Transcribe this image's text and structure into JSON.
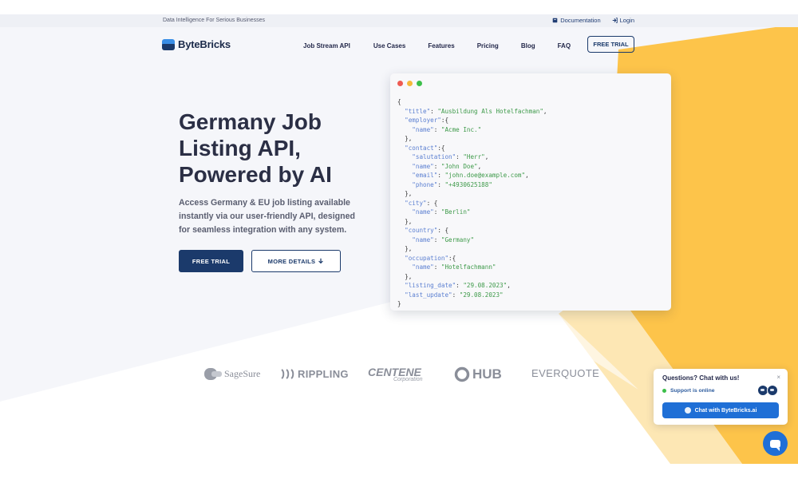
{
  "topbar": {
    "tagline": "Data Intelligence For Serious Businesses",
    "documentation": "Documentation",
    "login": "Login"
  },
  "nav": {
    "brand": "ByteBricks",
    "items": [
      "Job Stream API",
      "Use Cases",
      "Features",
      "Pricing",
      "Blog",
      "FAQ"
    ],
    "cta": "FREE TRIAL"
  },
  "hero": {
    "title_lines": [
      "Germany Job",
      "Listing API,",
      "Powered by AI"
    ],
    "subtitle": "Access Germany & EU job listing available instantly via our user-friendly API, designed for seamless integration with any system.",
    "primary_button": "FREE TRIAL",
    "secondary_button": "MORE DETAILS",
    "secondary_icon": "arrow-down-icon"
  },
  "code_sample": {
    "lines": [
      "{",
      "  \"title\": \"Ausbildung Als Hotelfachman\",",
      "  \"employer\":{",
      "    \"name\": \"Acme Inc.\"",
      "  },",
      "  \"contact\":{",
      "    \"salutation\": \"Herr\",",
      "    \"name\": \"John Doe\",",
      "    \"email\": \"john.doe@example.com\",",
      "    \"phone\": \"+4930625188\"",
      "  },",
      "  \"city\": {",
      "    \"name\": \"Berlin\"",
      "  },",
      "  \"country\": {",
      "    \"name\": \"Germany\"",
      "  },",
      "  \"occupation\":{",
      "    \"name\": \"Hotelfachmann\"",
      "  },",
      "  \"listing_date\": \"29.08.2023\",",
      "  \"last_update\": \"29.08.2023\"",
      "}"
    ]
  },
  "client_logos": [
    {
      "name": "SageSure"
    },
    {
      "name": "RIPPLING"
    },
    {
      "name": "CENTENE",
      "sub": "Corporation"
    },
    {
      "name": "HUB"
    },
    {
      "name": "EVERQUOTE"
    }
  ],
  "chat_widget": {
    "question": "Questions? Chat with us!",
    "close": "×",
    "status": "Support is online",
    "cta": "Chat with ByteBricks.ai"
  },
  "colors": {
    "brand_navy": "#1b3a6b",
    "accent_yellow": "#fdc44a",
    "chat_blue": "#1f6fd6",
    "online_green": "#3cbf4a"
  }
}
